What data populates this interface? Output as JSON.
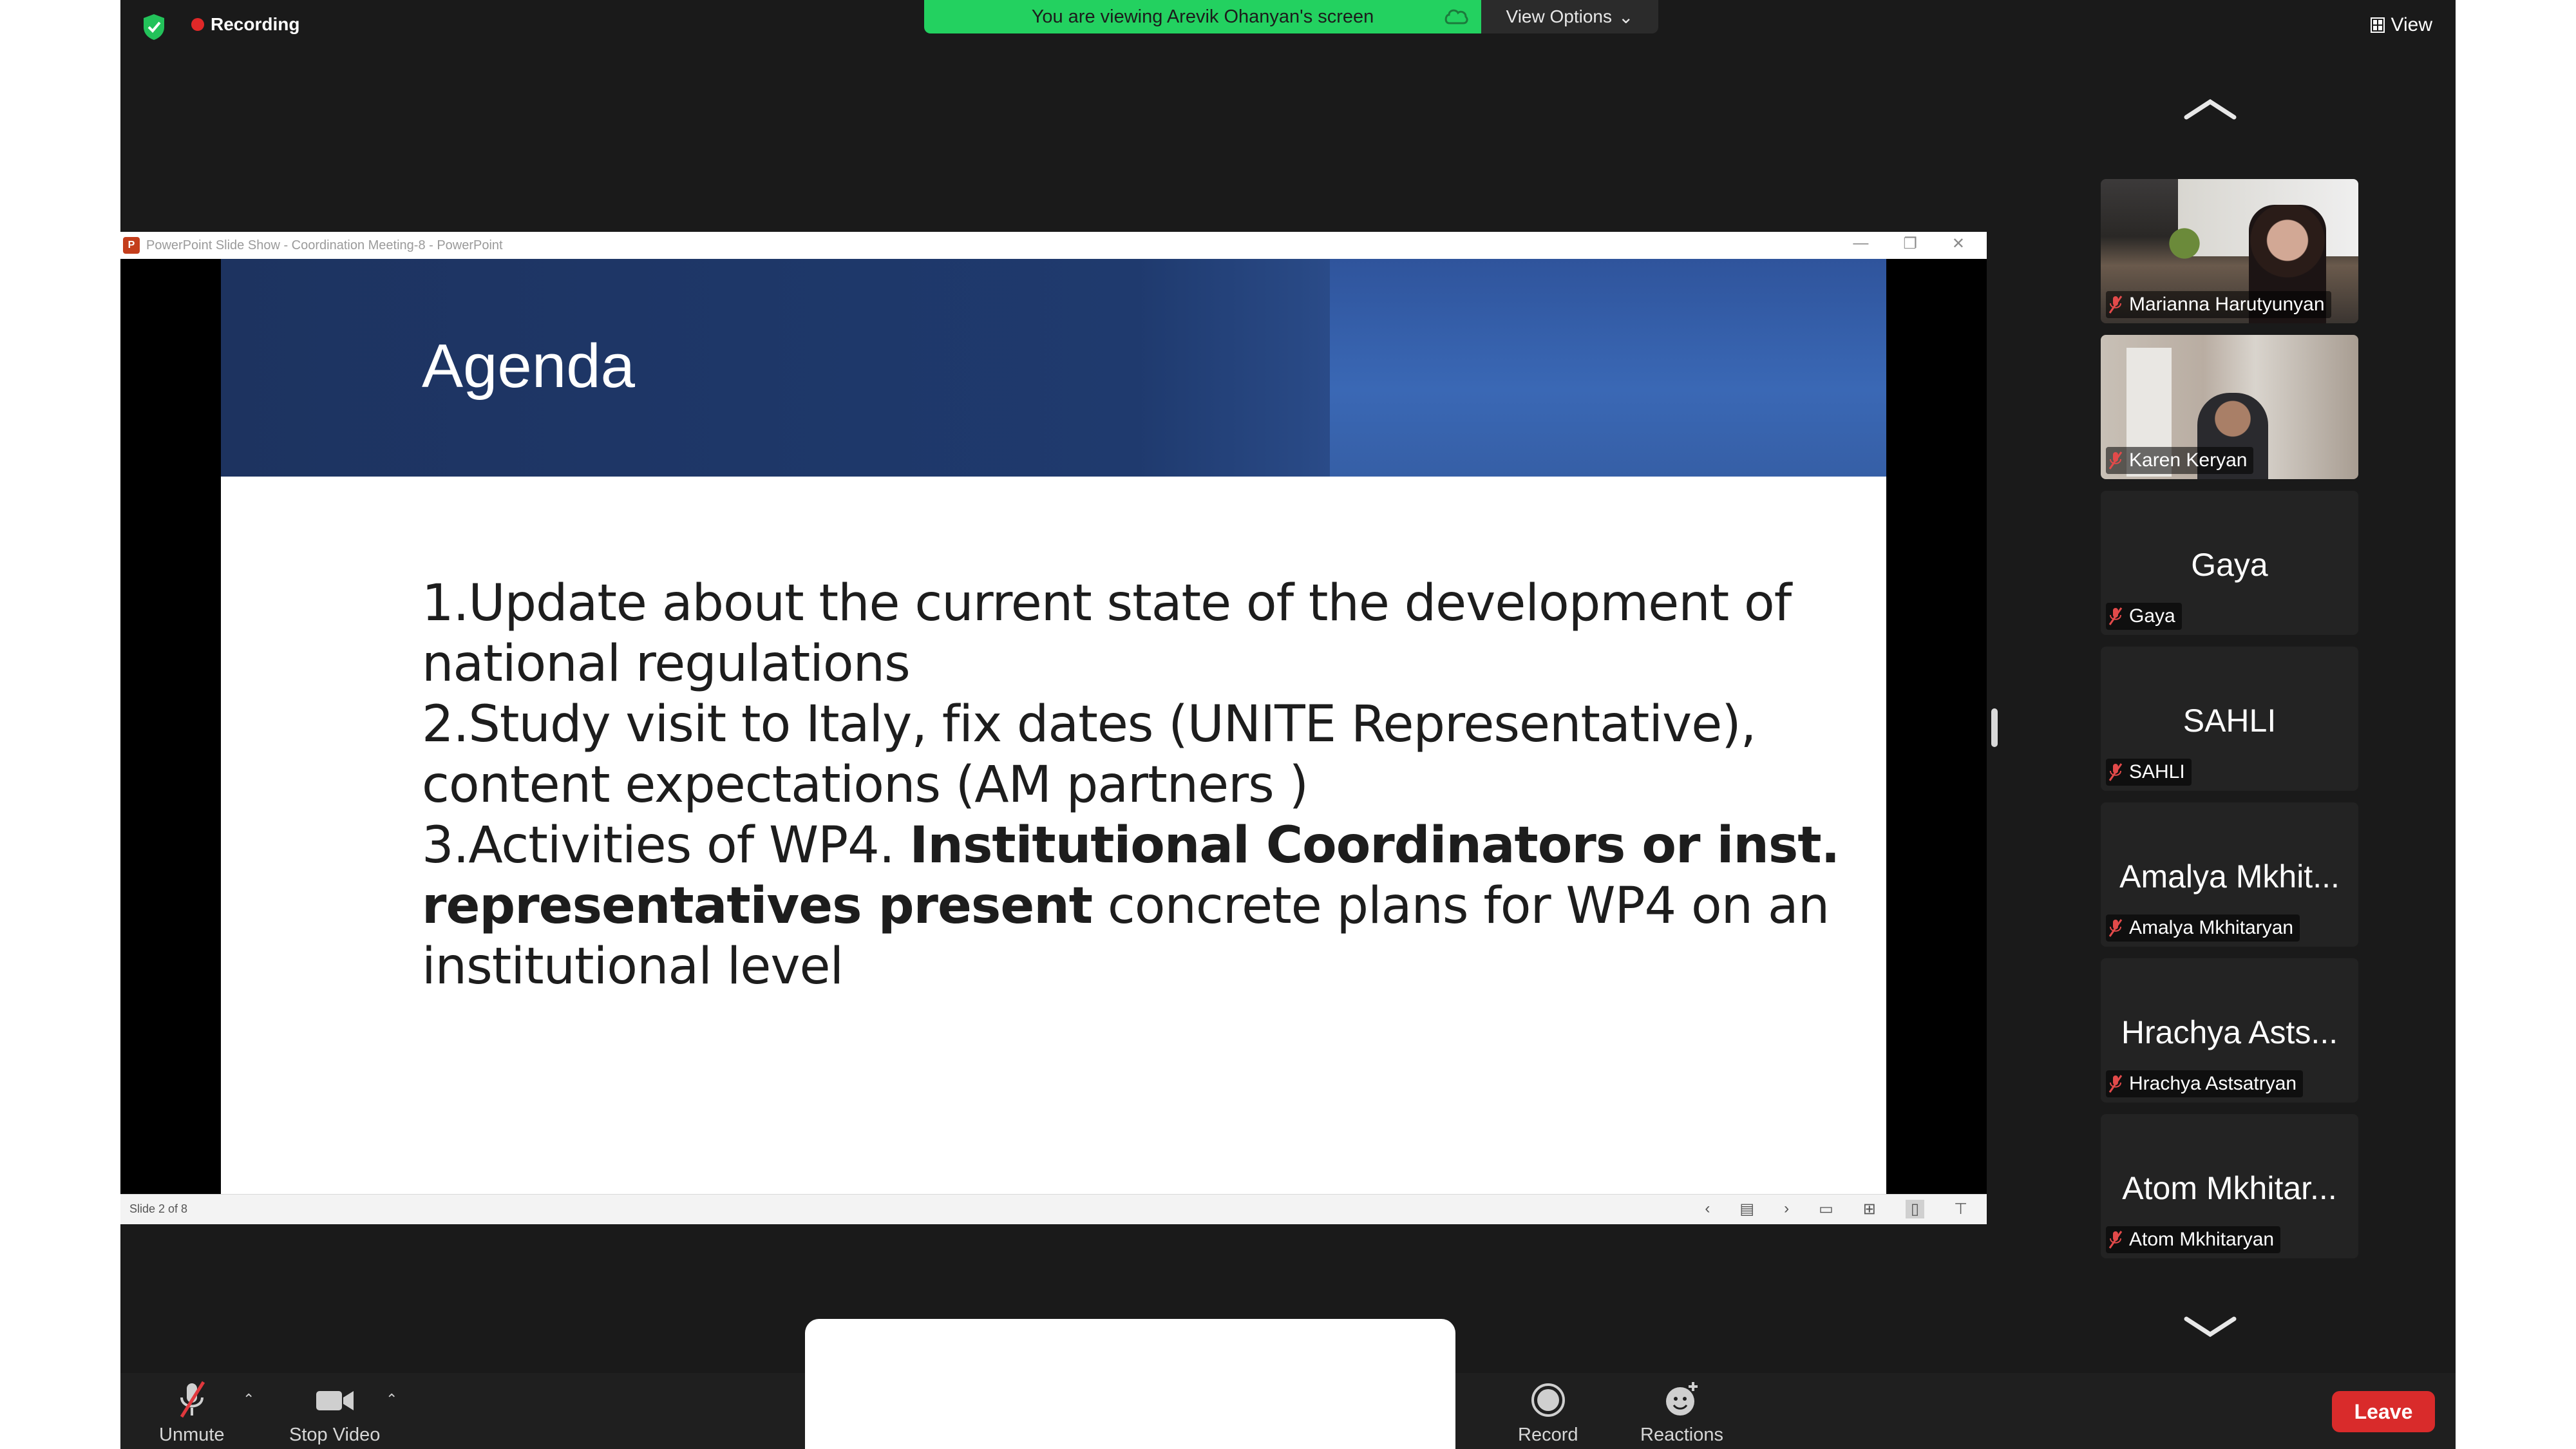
{
  "top_bar": {
    "recording_label": "Recording",
    "viewing_banner": "You are viewing Arevik Ohanyan's screen",
    "view_options_label": "View Options",
    "view_label": "View"
  },
  "ppt_window": {
    "title": "PowerPoint Slide Show  -  Coordination Meeting-8  -  PowerPoint",
    "status": "Slide 2 of 8"
  },
  "slide": {
    "title": "Agenda",
    "lines": [
      {
        "normal": "1.Update about the current state of the development of",
        "bold": "",
        "after": ""
      },
      {
        "normal": "national regulations",
        "bold": "",
        "after": ""
      },
      {
        "normal": "2.Study visit to Italy, fix dates (UNITE Representative),",
        "bold": "",
        "after": ""
      },
      {
        "normal": "content expectations (AM partners )",
        "bold": "",
        "after": ""
      },
      {
        "normal": "3.Activities of WP4. ",
        "bold": "Institutional Coordinators or inst.",
        "after": ""
      },
      {
        "normal": "",
        "bold": "representatives present",
        "after": " concrete plans for WP4  on an"
      },
      {
        "normal": "institutional level",
        "bold": "",
        "after": ""
      }
    ]
  },
  "participants": [
    {
      "name": "Marianna Harutyunyan",
      "display": "",
      "video": true
    },
    {
      "name": "Karen Keryan",
      "display": "",
      "video": true
    },
    {
      "name": "Gaya",
      "display": "Gaya",
      "video": false
    },
    {
      "name": "SAHLI",
      "display": "SAHLI",
      "video": false
    },
    {
      "name": "Amalya Mkhitaryan",
      "display": "Amalya Mkhit...",
      "video": false
    },
    {
      "name": "Hrachya Astsatryan",
      "display": "Hrachya Asts...",
      "video": false
    },
    {
      "name": "Atom Mkhitaryan",
      "display": "Atom Mkhitar...",
      "video": false
    }
  ],
  "toolbar": {
    "unmute_label": "Unmute",
    "stop_video_label": "Stop Video",
    "record_label": "Record",
    "reactions_label": "Reactions",
    "leave_label": "Leave"
  },
  "colors": {
    "banner_green": "#23d160",
    "leave_red": "#d92b2b",
    "recording_red": "#e02828",
    "background": "#1a1a1a"
  }
}
